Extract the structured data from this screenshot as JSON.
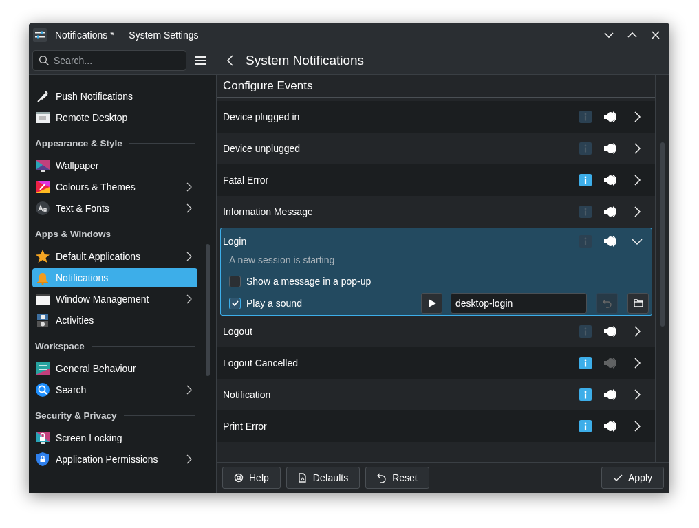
{
  "window": {
    "title": "Notifications * — System Settings"
  },
  "search": {
    "placeholder": "Search..."
  },
  "page_title": "System Notifications",
  "sidebar": {
    "items": [
      {
        "kind": "item",
        "label": "Push Notifications",
        "arrow": false,
        "selected": false
      },
      {
        "kind": "item",
        "label": "Remote Desktop",
        "arrow": false,
        "selected": false
      },
      {
        "kind": "header",
        "label": "Appearance & Style"
      },
      {
        "kind": "item",
        "label": "Wallpaper",
        "arrow": false,
        "selected": false
      },
      {
        "kind": "item",
        "label": "Colours & Themes",
        "arrow": true,
        "selected": false
      },
      {
        "kind": "item",
        "label": "Text & Fonts",
        "arrow": true,
        "selected": false
      },
      {
        "kind": "header",
        "label": "Apps & Windows"
      },
      {
        "kind": "item",
        "label": "Default Applications",
        "arrow": true,
        "selected": false
      },
      {
        "kind": "item",
        "label": "Notifications",
        "arrow": false,
        "selected": true
      },
      {
        "kind": "item",
        "label": "Window Management",
        "arrow": true,
        "selected": false
      },
      {
        "kind": "item",
        "label": "Activities",
        "arrow": false,
        "selected": false
      },
      {
        "kind": "header",
        "label": "Workspace"
      },
      {
        "kind": "item",
        "label": "General Behaviour",
        "arrow": false,
        "selected": false
      },
      {
        "kind": "item",
        "label": "Search",
        "arrow": true,
        "selected": false
      },
      {
        "kind": "header",
        "label": "Security & Privacy"
      },
      {
        "kind": "item",
        "label": "Screen Locking",
        "arrow": false,
        "selected": false
      },
      {
        "kind": "item",
        "label": "Application Permissions",
        "arrow": true,
        "selected": false
      }
    ]
  },
  "section_title": "Configure Events",
  "events": [
    {
      "name": "Device plugged in",
      "popup": false,
      "sound": true,
      "expanded": false
    },
    {
      "name": "Device unplugged",
      "popup": false,
      "sound": true,
      "expanded": false
    },
    {
      "name": "Fatal Error",
      "popup": true,
      "sound": true,
      "expanded": false
    },
    {
      "name": "Information Message",
      "popup": false,
      "sound": true,
      "expanded": false
    },
    {
      "name": "Login",
      "popup": false,
      "sound": true,
      "expanded": true,
      "details": {
        "description": "A new session is starting",
        "options": [
          {
            "label": "Show a message in a pop-up",
            "checked": false
          },
          {
            "label": "Play a sound",
            "checked": true
          }
        ],
        "sound_file": "desktop-login"
      }
    },
    {
      "name": "Logout",
      "popup": false,
      "sound": true,
      "expanded": false
    },
    {
      "name": "Logout Cancelled",
      "popup": true,
      "sound": false,
      "expanded": false
    },
    {
      "name": "Notification",
      "popup": true,
      "sound": true,
      "expanded": false
    },
    {
      "name": "Print Error",
      "popup": true,
      "sound": true,
      "expanded": false
    }
  ],
  "footer": {
    "buttons": [
      {
        "label": "Help",
        "kind": "help"
      },
      {
        "label": "Defaults",
        "kind": "defaults"
      },
      {
        "label": "Reset",
        "kind": "reset"
      }
    ],
    "apply": "Apply"
  }
}
